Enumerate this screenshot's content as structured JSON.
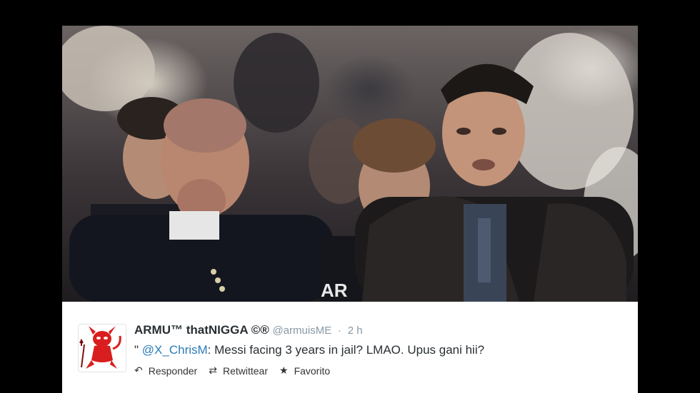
{
  "photo": {
    "alt_label": "photo",
    "jersey_text": "AR"
  },
  "tweet": {
    "display_name": "ARMU™ thatNIGGA ©®",
    "handle": "@armuisME",
    "separator": "·",
    "time": "2 h",
    "quote_mark": "\"",
    "mention": "@X_ChrisM",
    "text": ": Messi facing 3 years in jail? LMAO. Upus gani hii?",
    "actions": {
      "reply_label": "Responder",
      "retweet_label": "Retwittear",
      "favorite_label": "Favorito"
    }
  },
  "colors": {
    "background": "#000000",
    "card": "#ffffff",
    "link": "#2b7bb9",
    "muted": "#8899a6",
    "avatar_red": "#d81e1e"
  }
}
